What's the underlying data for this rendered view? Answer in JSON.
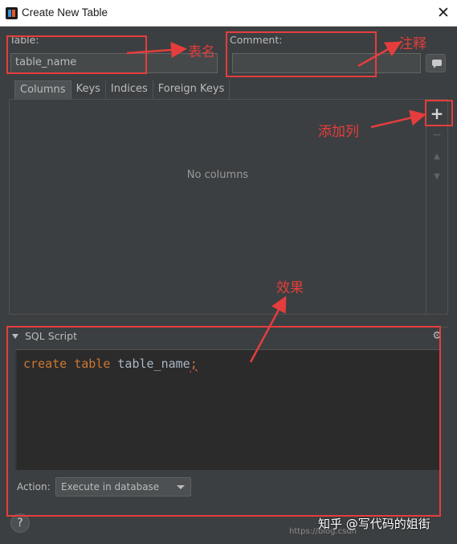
{
  "window": {
    "title": "Create New Table",
    "close": "✕"
  },
  "form": {
    "table_label": "Table:",
    "table_value": "table_name",
    "comment_label": "Comment:",
    "comment_value": ""
  },
  "tabs": [
    {
      "label": "Columns",
      "active": true
    },
    {
      "label": "Keys",
      "active": false
    },
    {
      "label": "Indices",
      "active": false
    },
    {
      "label": "Foreign Keys",
      "active": false
    }
  ],
  "columns": {
    "empty_text": "No columns"
  },
  "toolbar": {
    "add": "+",
    "remove": "−",
    "up": "▲",
    "down": "▼"
  },
  "sql": {
    "title": "SQL Script",
    "code_kw1": "create",
    "code_kw2": "table",
    "code_name": "table_name",
    "code_semi": ";"
  },
  "action": {
    "label": "Action:",
    "selected": "Execute in database"
  },
  "help": "?",
  "annotations": {
    "table_name": "表名",
    "comment": "注释",
    "add_column": "添加列",
    "effect": "效果",
    "color": "#e53d3d"
  },
  "watermark": "知乎 @写代码的姐街",
  "faint_url": "https://blog.csdn"
}
